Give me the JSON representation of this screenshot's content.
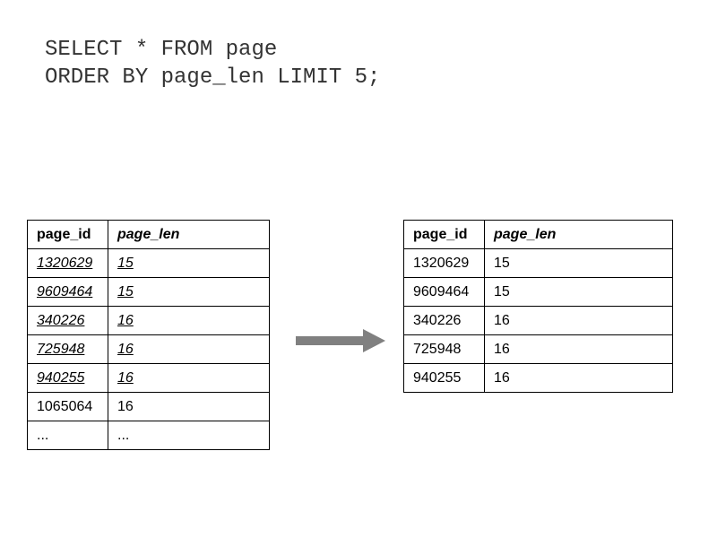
{
  "sql": {
    "line1": "SELECT * FROM page",
    "line2": "ORDER BY page_len LIMIT 5;"
  },
  "left_table": {
    "headers": {
      "col1": "page_id",
      "col2": "page_len"
    },
    "rows": [
      {
        "page_id": "1320629",
        "page_len": "15",
        "highlighted": true
      },
      {
        "page_id": "9609464",
        "page_len": "15",
        "highlighted": true
      },
      {
        "page_id": "340226",
        "page_len": "16",
        "highlighted": true
      },
      {
        "page_id": "725948",
        "page_len": "16",
        "highlighted": true
      },
      {
        "page_id": "940255",
        "page_len": "16",
        "highlighted": true
      },
      {
        "page_id": "1065064",
        "page_len": "16",
        "highlighted": false
      },
      {
        "page_id": "...",
        "page_len": "...",
        "highlighted": false
      }
    ]
  },
  "right_table": {
    "headers": {
      "col1": "page_id",
      "col2": "page_len"
    },
    "rows": [
      {
        "page_id": "1320629",
        "page_len": "15"
      },
      {
        "page_id": "9609464",
        "page_len": "15"
      },
      {
        "page_id": "340226",
        "page_len": "16"
      },
      {
        "page_id": "725948",
        "page_len": "16"
      },
      {
        "page_id": "940255",
        "page_len": "16"
      }
    ]
  }
}
